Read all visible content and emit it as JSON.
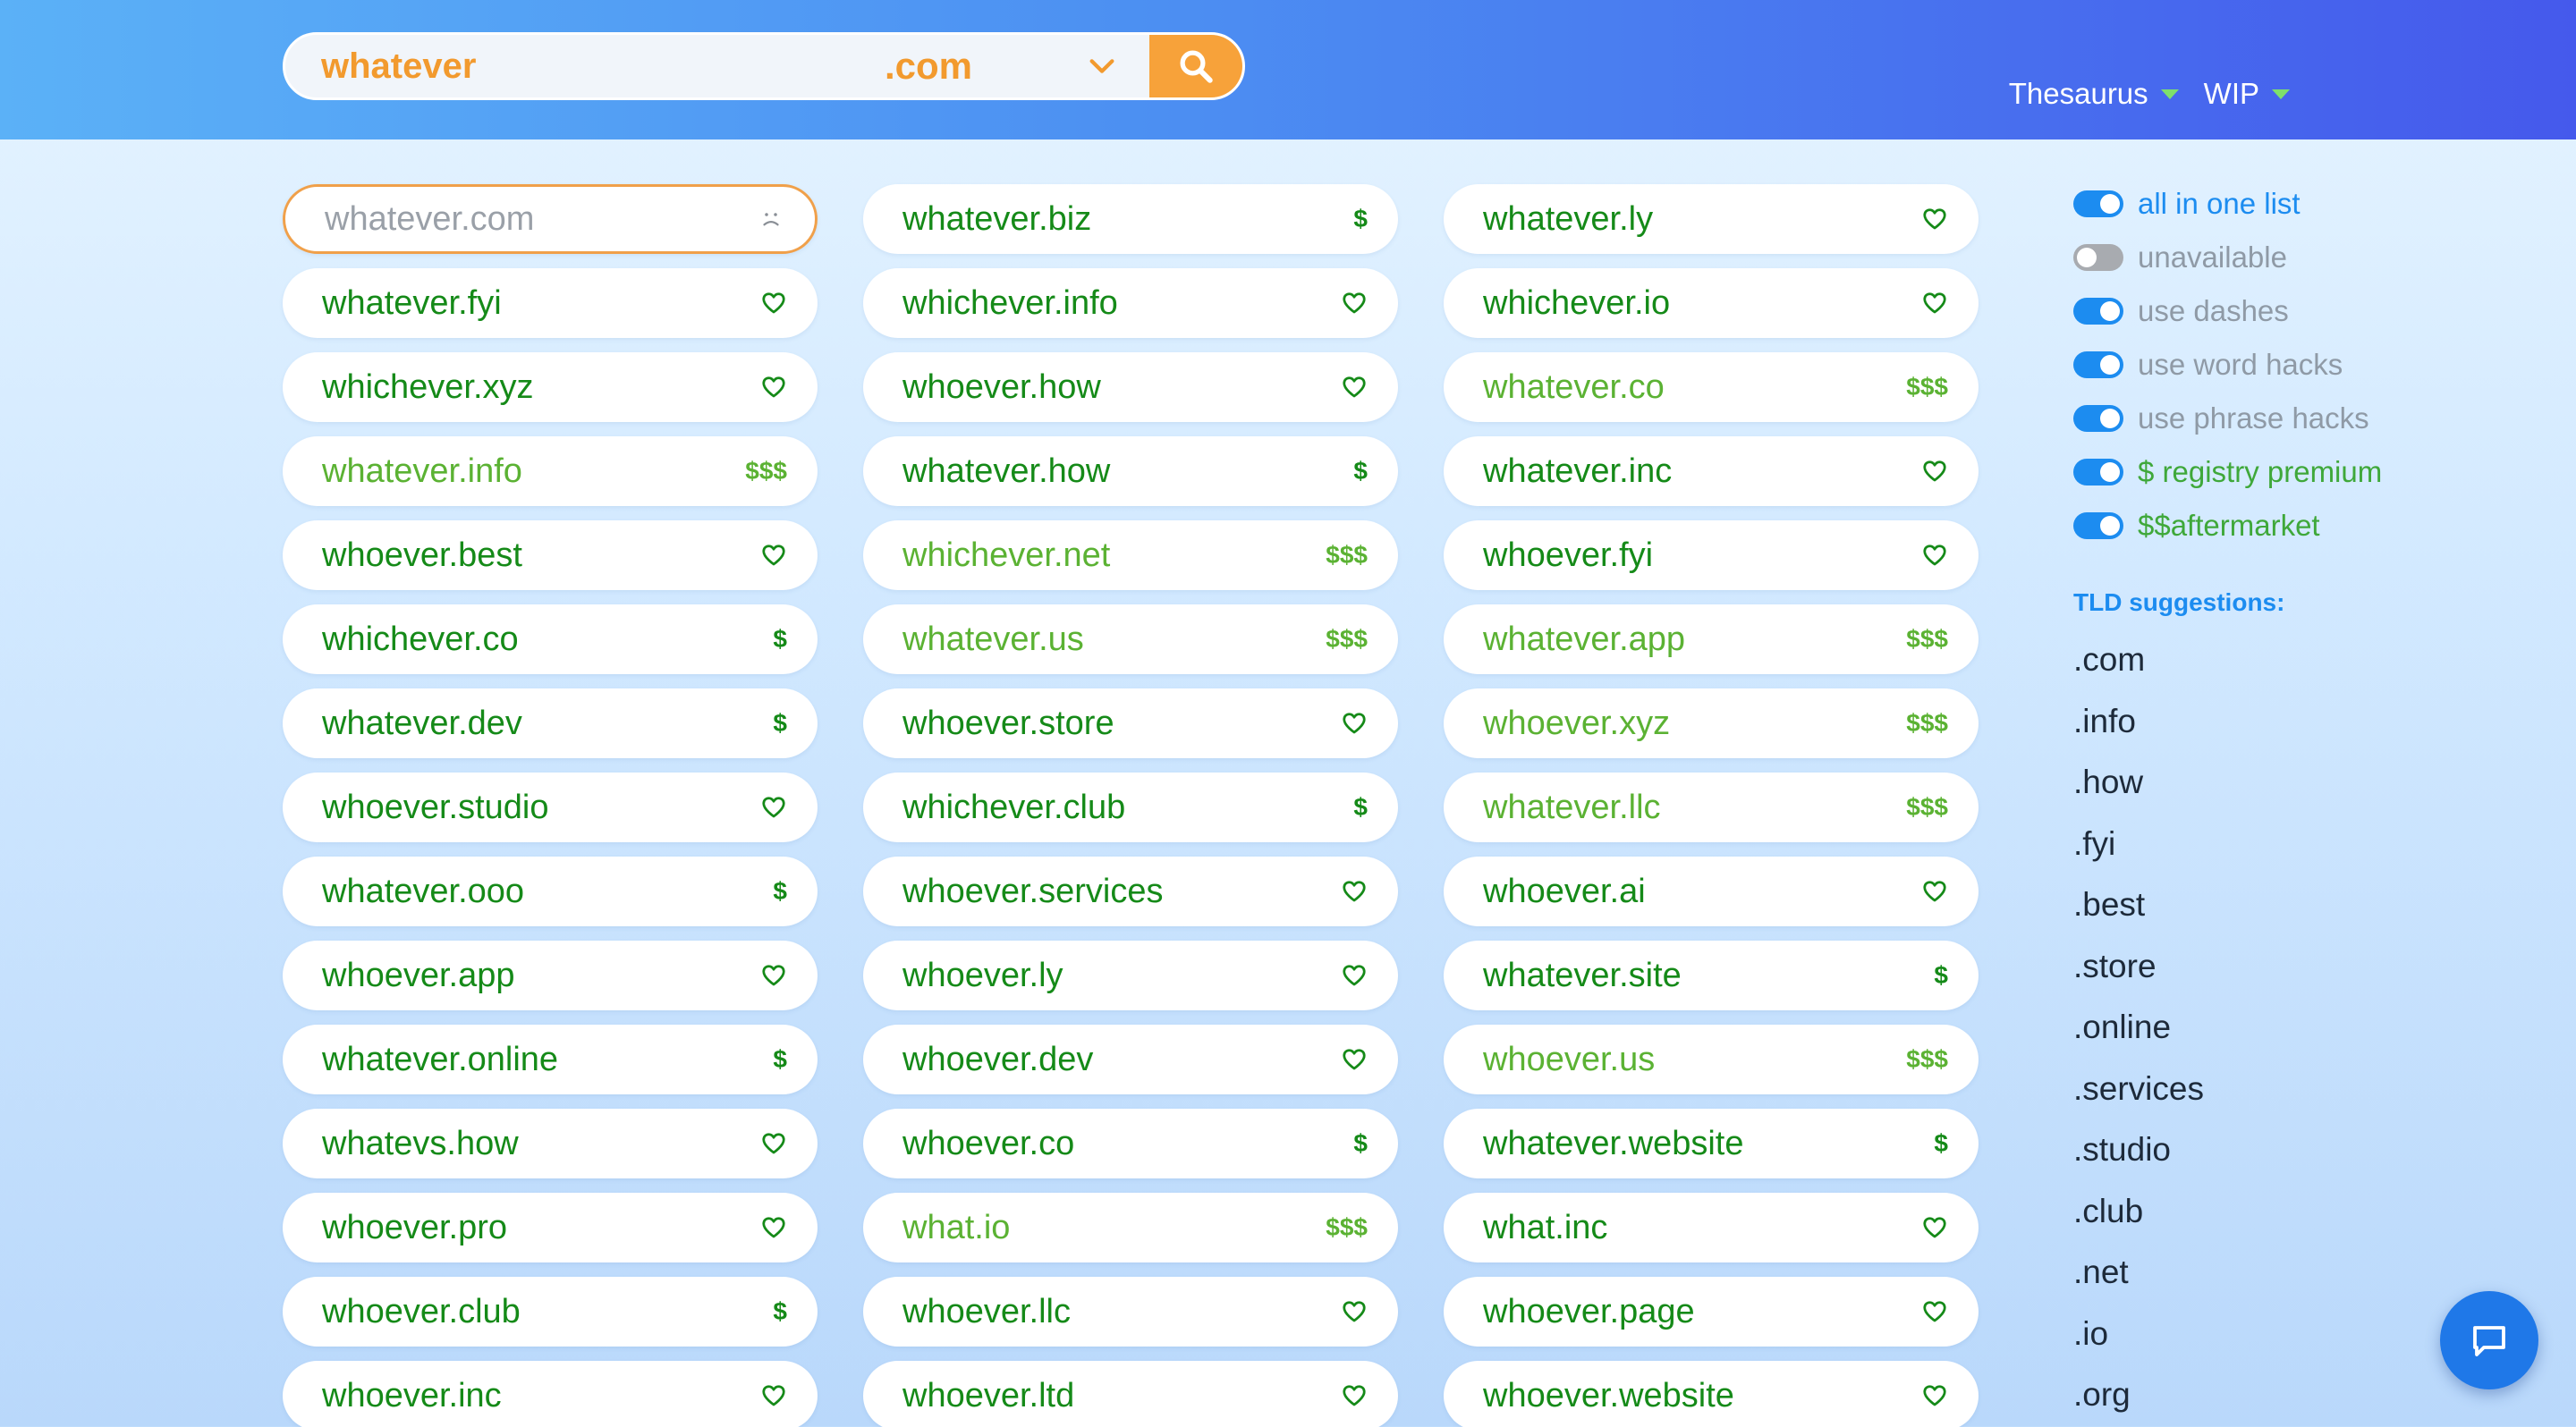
{
  "header": {
    "search_value": "whatever",
    "tld_selected": ".com",
    "nav": [
      {
        "label": "Thesaurus"
      },
      {
        "label": "WIP"
      }
    ]
  },
  "results": [
    {
      "name": "whatever.com",
      "status": "unavailable",
      "icon": "sad-face-icon",
      "badge": ""
    },
    {
      "name": "whatever.biz",
      "status": "available",
      "icon": "dollar-icon",
      "badge": "$"
    },
    {
      "name": "whatever.ly",
      "status": "available",
      "icon": "heart-icon",
      "badge": ""
    },
    {
      "name": "whatever.fyi",
      "status": "available",
      "icon": "heart-icon",
      "badge": ""
    },
    {
      "name": "whichever.info",
      "status": "available",
      "icon": "heart-icon",
      "badge": ""
    },
    {
      "name": "whichever.io",
      "status": "available",
      "icon": "heart-icon",
      "badge": ""
    },
    {
      "name": "whichever.xyz",
      "status": "available",
      "icon": "heart-icon",
      "badge": ""
    },
    {
      "name": "whoever.how",
      "status": "available",
      "icon": "heart-icon",
      "badge": ""
    },
    {
      "name": "whatever.co",
      "status": "premium",
      "icon": "dollar-icon",
      "badge": "$$$"
    },
    {
      "name": "whatever.info",
      "status": "premium",
      "icon": "dollar-icon",
      "badge": "$$$"
    },
    {
      "name": "whatever.how",
      "status": "available",
      "icon": "dollar-icon",
      "badge": "$"
    },
    {
      "name": "whatever.inc",
      "status": "available",
      "icon": "heart-icon",
      "badge": ""
    },
    {
      "name": "whoever.best",
      "status": "available",
      "icon": "heart-icon",
      "badge": ""
    },
    {
      "name": "whichever.net",
      "status": "premium",
      "icon": "dollar-icon",
      "badge": "$$$"
    },
    {
      "name": "whoever.fyi",
      "status": "available",
      "icon": "heart-icon",
      "badge": ""
    },
    {
      "name": "whichever.co",
      "status": "available",
      "icon": "dollar-icon",
      "badge": "$"
    },
    {
      "name": "whatever.us",
      "status": "premium",
      "icon": "dollar-icon",
      "badge": "$$$"
    },
    {
      "name": "whatever.app",
      "status": "premium",
      "icon": "dollar-icon",
      "badge": "$$$"
    },
    {
      "name": "whatever.dev",
      "status": "available",
      "icon": "dollar-icon",
      "badge": "$"
    },
    {
      "name": "whoever.store",
      "status": "available",
      "icon": "heart-icon",
      "badge": ""
    },
    {
      "name": "whoever.xyz",
      "status": "premium",
      "icon": "dollar-icon",
      "badge": "$$$"
    },
    {
      "name": "whoever.studio",
      "status": "available",
      "icon": "heart-icon",
      "badge": ""
    },
    {
      "name": "whichever.club",
      "status": "available",
      "icon": "dollar-icon",
      "badge": "$"
    },
    {
      "name": "whatever.llc",
      "status": "premium",
      "icon": "dollar-icon",
      "badge": "$$$"
    },
    {
      "name": "whatever.ooo",
      "status": "available",
      "icon": "dollar-icon",
      "badge": "$"
    },
    {
      "name": "whoever.services",
      "status": "available",
      "icon": "heart-icon",
      "badge": ""
    },
    {
      "name": "whoever.ai",
      "status": "available",
      "icon": "heart-icon",
      "badge": ""
    },
    {
      "name": "whoever.app",
      "status": "available",
      "icon": "heart-icon",
      "badge": ""
    },
    {
      "name": "whoever.ly",
      "status": "available",
      "icon": "heart-icon",
      "badge": ""
    },
    {
      "name": "whatever.site",
      "status": "available",
      "icon": "dollar-icon",
      "badge": "$"
    },
    {
      "name": "whatever.online",
      "status": "available",
      "icon": "dollar-icon",
      "badge": "$"
    },
    {
      "name": "whoever.dev",
      "status": "available",
      "icon": "heart-icon",
      "badge": ""
    },
    {
      "name": "whoever.us",
      "status": "premium",
      "icon": "dollar-icon",
      "badge": "$$$"
    },
    {
      "name": "whatevs.how",
      "status": "available",
      "icon": "heart-icon",
      "badge": ""
    },
    {
      "name": "whoever.co",
      "status": "available",
      "icon": "dollar-icon",
      "badge": "$"
    },
    {
      "name": "whatever.website",
      "status": "available",
      "icon": "dollar-icon",
      "badge": "$"
    },
    {
      "name": "whoever.pro",
      "status": "available",
      "icon": "heart-icon",
      "badge": ""
    },
    {
      "name": "what.io",
      "status": "premium",
      "icon": "dollar-icon",
      "badge": "$$$"
    },
    {
      "name": "what.inc",
      "status": "available",
      "icon": "heart-icon",
      "badge": ""
    },
    {
      "name": "whoever.club",
      "status": "available",
      "icon": "dollar-icon",
      "badge": "$"
    },
    {
      "name": "whoever.llc",
      "status": "available",
      "icon": "heart-icon",
      "badge": ""
    },
    {
      "name": "whoever.page",
      "status": "available",
      "icon": "heart-icon",
      "badge": ""
    },
    {
      "name": "whoever.inc",
      "status": "available",
      "icon": "heart-icon",
      "badge": ""
    },
    {
      "name": "whoever.ltd",
      "status": "available",
      "icon": "heart-icon",
      "badge": ""
    },
    {
      "name": "whoever.website",
      "status": "available",
      "icon": "heart-icon",
      "badge": ""
    }
  ],
  "sidebar": {
    "toggles": [
      {
        "label": "all in one list",
        "on": true,
        "style": "accent"
      },
      {
        "label": "unavailable",
        "on": false,
        "style": "muted"
      },
      {
        "label": "use dashes",
        "on": true,
        "style": "muted"
      },
      {
        "label": "use word hacks",
        "on": true,
        "style": "muted"
      },
      {
        "label": "use phrase hacks",
        "on": true,
        "style": "muted"
      },
      {
        "label": "$ registry premium",
        "on": true,
        "style": "green"
      },
      {
        "label": "$$aftermarket",
        "on": true,
        "style": "green"
      }
    ],
    "tld_heading": "TLD suggestions:",
    "tlds": [
      ".com",
      ".info",
      ".how",
      ".fyi",
      ".best",
      ".store",
      ".online",
      ".services",
      ".studio",
      ".club",
      ".net",
      ".io",
      ".org"
    ]
  },
  "colors": {
    "available": "#158a18",
    "premium": "#5bb233",
    "accent": "#1c8cf0",
    "search_text": "#f29a2e"
  }
}
